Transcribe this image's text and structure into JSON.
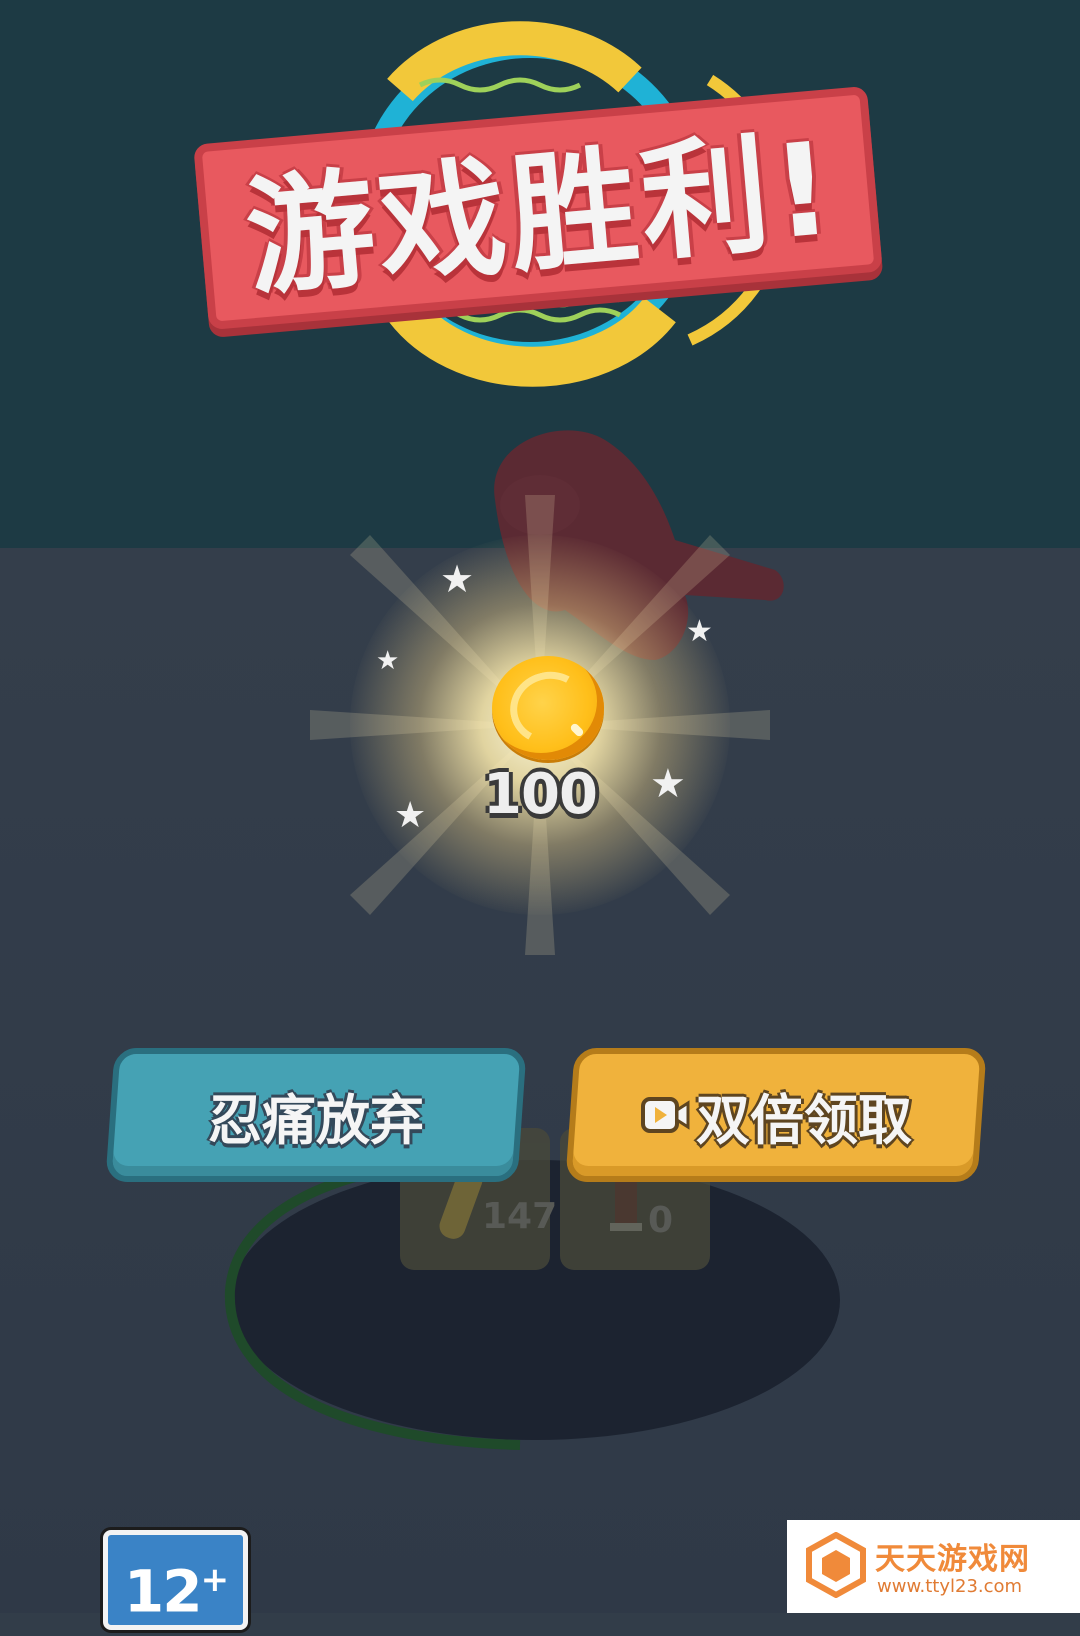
{
  "title": "游戏胜利!",
  "reward": {
    "amount": "100",
    "icon": "gold-coin-icon"
  },
  "buttons": {
    "give_up_label": "忍痛放弃",
    "double_claim_label": "双倍领取",
    "double_claim_icon": "video-play-icon"
  },
  "inventory": {
    "ammo_count": "147",
    "weapon_count": "0"
  },
  "age_rating": {
    "label": "12",
    "plus": "+"
  },
  "watermark": {
    "name": "天天游戏网",
    "url": "www.ttyl23.com"
  },
  "colors": {
    "sky": "#1d3a44",
    "ground": "#323d49",
    "title_banner": "#e8595f",
    "give_up_button": "#45a2b4",
    "double_claim_button": "#f0b23c",
    "coin": "#ffbf1a"
  }
}
